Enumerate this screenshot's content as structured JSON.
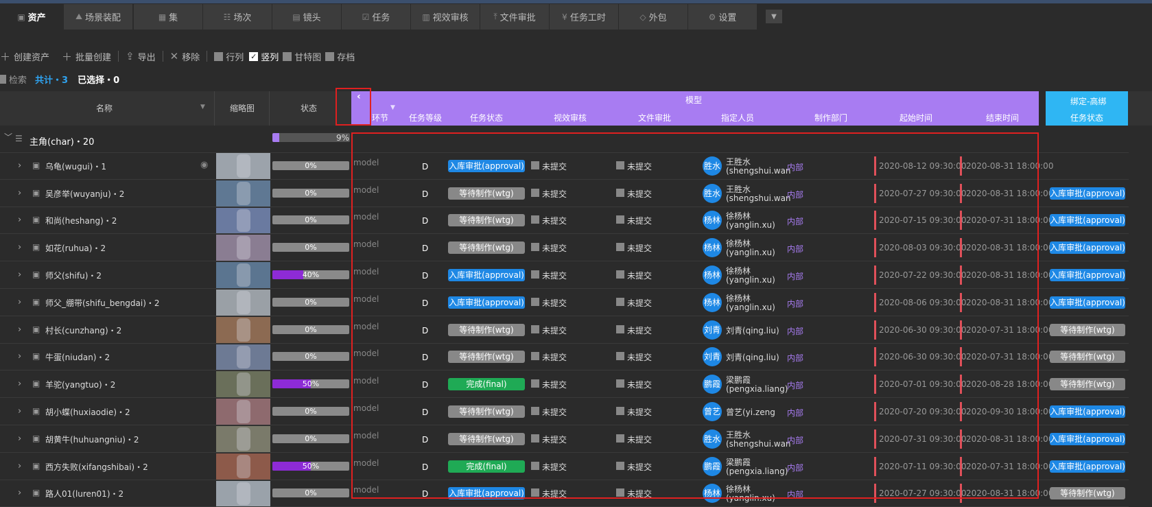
{
  "tabs": [
    {
      "label": "资产",
      "icon": "briefcase-icon"
    },
    {
      "label": "场景装配",
      "icon": "landscape-icon"
    },
    {
      "label": "集",
      "icon": "grid-icon"
    },
    {
      "label": "场次",
      "icon": "list-icon"
    },
    {
      "label": "镜头",
      "icon": "clapper-icon"
    },
    {
      "label": "任务",
      "icon": "check-icon"
    },
    {
      "label": "视效审核",
      "icon": "film-icon"
    },
    {
      "label": "文件审批",
      "icon": "upload-icon"
    },
    {
      "label": "任务工时",
      "icon": "yen-icon"
    },
    {
      "label": "外包",
      "icon": "tag-icon"
    },
    {
      "label": "设置",
      "icon": "gear-icon"
    }
  ],
  "toolbar": {
    "create_asset": "创建资产",
    "batch_create": "批量创建",
    "export": "导出",
    "remove": "移除",
    "view_row": "行列",
    "view_col": "竖列",
    "view_gantt": "甘特图",
    "view_archive": "存档"
  },
  "info": {
    "search": "检索",
    "total": "共计・3",
    "selected": "已选择・0"
  },
  "headers": {
    "name": "名称",
    "thumb": "缩略图",
    "status": "状态",
    "group_model": "模型",
    "group_bind": "绑定-高绑",
    "step": "环节",
    "level": "任务等级",
    "task_status": "任务状态",
    "vfx_review": "视效审核",
    "file_approval": "文件审批",
    "assignee": "指定人员",
    "department": "制作部门",
    "start": "起始时间",
    "end": "结束时间",
    "bind_status": "任务状态"
  },
  "group": {
    "label": "主角(char)・20",
    "progress": "9%",
    "progress_value": 9
  },
  "rows": [
    {
      "name": "乌龟(wugui)・1",
      "progress": "0%",
      "pv": 0,
      "step": "model",
      "level": "D",
      "status": "入库审批(approval)",
      "st": "approval",
      "vfx": "未提交",
      "file": "未提交",
      "avatar": "胜水",
      "person": "王胜水",
      "person2": "(shengshui.wan",
      "dept": "内部",
      "start": "2020-08-12 09:30:00",
      "end": "2020-08-31 18:00:00",
      "bind": "",
      "bst": ""
    },
    {
      "name": "吴彦举(wuyanju)・2",
      "progress": "0%",
      "pv": 0,
      "step": "model",
      "level": "D",
      "status": "等待制作(wtg)",
      "st": "wtg",
      "vfx": "未提交",
      "file": "未提交",
      "avatar": "胜水",
      "person": "王胜水",
      "person2": "(shengshui.wan",
      "dept": "内部",
      "start": "2020-07-27 09:30:00",
      "end": "2020-08-31 18:00:00",
      "bind": "入库审批(approval)",
      "bst": "approval"
    },
    {
      "name": "和尚(heshang)・2",
      "progress": "0%",
      "pv": 0,
      "step": "model",
      "level": "D",
      "status": "等待制作(wtg)",
      "st": "wtg",
      "vfx": "未提交",
      "file": "未提交",
      "avatar": "杨林",
      "person": "徐杨林",
      "person2": "(yanglin.xu)",
      "dept": "内部",
      "start": "2020-07-15 09:30:00",
      "end": "2020-07-31 18:00:00",
      "bind": "入库审批(approval)",
      "bst": "approval"
    },
    {
      "name": "如花(ruhua)・2",
      "progress": "0%",
      "pv": 0,
      "step": "model",
      "level": "D",
      "status": "等待制作(wtg)",
      "st": "wtg",
      "vfx": "未提交",
      "file": "未提交",
      "avatar": "杨林",
      "person": "徐杨林",
      "person2": "(yanglin.xu)",
      "dept": "内部",
      "start": "2020-08-03 09:30:00",
      "end": "2020-08-31 18:00:00",
      "bind": "入库审批(approval)",
      "bst": "approval"
    },
    {
      "name": "师父(shifu)・2",
      "progress": "40%",
      "pv": 40,
      "step": "model",
      "level": "D",
      "status": "入库审批(approval)",
      "st": "approval",
      "vfx": "未提交",
      "file": "未提交",
      "avatar": "杨林",
      "person": "徐杨林",
      "person2": "(yanglin.xu)",
      "dept": "内部",
      "start": "2020-07-22 09:30:00",
      "end": "2020-08-31 18:00:00",
      "bind": "入库审批(approval)",
      "bst": "approval"
    },
    {
      "name": "师父_绷带(shifu_bengdai)・2",
      "progress": "0%",
      "pv": 0,
      "step": "model",
      "level": "D",
      "status": "入库审批(approval)",
      "st": "approval",
      "vfx": "未提交",
      "file": "未提交",
      "avatar": "杨林",
      "person": "徐杨林",
      "person2": "(yanglin.xu)",
      "dept": "内部",
      "start": "2020-08-06 09:30:00",
      "end": "2020-08-31 18:00:00",
      "bind": "入库审批(approval)",
      "bst": "approval"
    },
    {
      "name": "村长(cunzhang)・2",
      "progress": "0%",
      "pv": 0,
      "step": "model",
      "level": "D",
      "status": "等待制作(wtg)",
      "st": "wtg",
      "vfx": "未提交",
      "file": "未提交",
      "avatar": "刘青",
      "person": "刘青(qing.liu)",
      "person2": "",
      "dept": "内部",
      "start": "2020-06-30 09:30:00",
      "end": "2020-07-31 18:00:00",
      "bind": "等待制作(wtg)",
      "bst": "wtg"
    },
    {
      "name": "牛蛋(niudan)・2",
      "progress": "0%",
      "pv": 0,
      "step": "model",
      "level": "D",
      "status": "等待制作(wtg)",
      "st": "wtg",
      "vfx": "未提交",
      "file": "未提交",
      "avatar": "刘青",
      "person": "刘青(qing.liu)",
      "person2": "",
      "dept": "内部",
      "start": "2020-06-30 09:30:00",
      "end": "2020-07-31 18:00:00",
      "bind": "等待制作(wtg)",
      "bst": "wtg"
    },
    {
      "name": "羊驼(yangtuo)・2",
      "progress": "50%",
      "pv": 50,
      "step": "model",
      "level": "D",
      "status": "完成(final)",
      "st": "final",
      "vfx": "未提交",
      "file": "未提交",
      "avatar": "鹏霞",
      "person": "梁鹏霞",
      "person2": "(pengxia.liang)",
      "dept": "内部",
      "start": "2020-07-01 09:30:00",
      "end": "2020-08-28 18:00:00",
      "bind": "等待制作(wtg)",
      "bst": "wtg"
    },
    {
      "name": "胡小蝶(huxiaodie)・2",
      "progress": "0%",
      "pv": 0,
      "step": "model",
      "level": "D",
      "status": "等待制作(wtg)",
      "st": "wtg",
      "vfx": "未提交",
      "file": "未提交",
      "avatar": "曾艺",
      "person": "曾艺(yi.zeng",
      "person2": "",
      "dept": "内部",
      "start": "2020-07-20 09:30:00",
      "end": "2020-09-30 18:00:00",
      "bind": "入库审批(approval)",
      "bst": "approval"
    },
    {
      "name": "胡黄牛(huhuangniu)・2",
      "progress": "0%",
      "pv": 0,
      "step": "model",
      "level": "D",
      "status": "等待制作(wtg)",
      "st": "wtg",
      "vfx": "未提交",
      "file": "未提交",
      "avatar": "胜水",
      "person": "王胜水",
      "person2": "(shengshui.wan",
      "dept": "内部",
      "start": "2020-07-31 09:30:00",
      "end": "2020-08-31 18:00:00",
      "bind": "入库审批(approval)",
      "bst": "approval"
    },
    {
      "name": "西方失败(xifangshibai)・2",
      "progress": "50%",
      "pv": 50,
      "step": "model",
      "level": "D",
      "status": "完成(final)",
      "st": "final",
      "vfx": "未提交",
      "file": "未提交",
      "avatar": "鹏霞",
      "person": "梁鹏霞",
      "person2": "(pengxia.liang)",
      "dept": "内部",
      "start": "2020-07-11 09:30:00",
      "end": "2020-07-31 18:00:00",
      "bind": "入库审批(approval)",
      "bst": "approval"
    },
    {
      "name": "路人01(luren01)・2",
      "progress": "0%",
      "pv": 0,
      "step": "model",
      "level": "D",
      "status": "入库审批(approval)",
      "st": "approval",
      "vfx": "未提交",
      "file": "未提交",
      "avatar": "杨林",
      "person": "徐杨林",
      "person2": "(yanglin.xu)",
      "dept": "内部",
      "start": "2020-07-27 09:30:00",
      "end": "2020-08-31 18:00:00",
      "bind": "等待制作(wtg)",
      "bst": "wtg"
    }
  ]
}
